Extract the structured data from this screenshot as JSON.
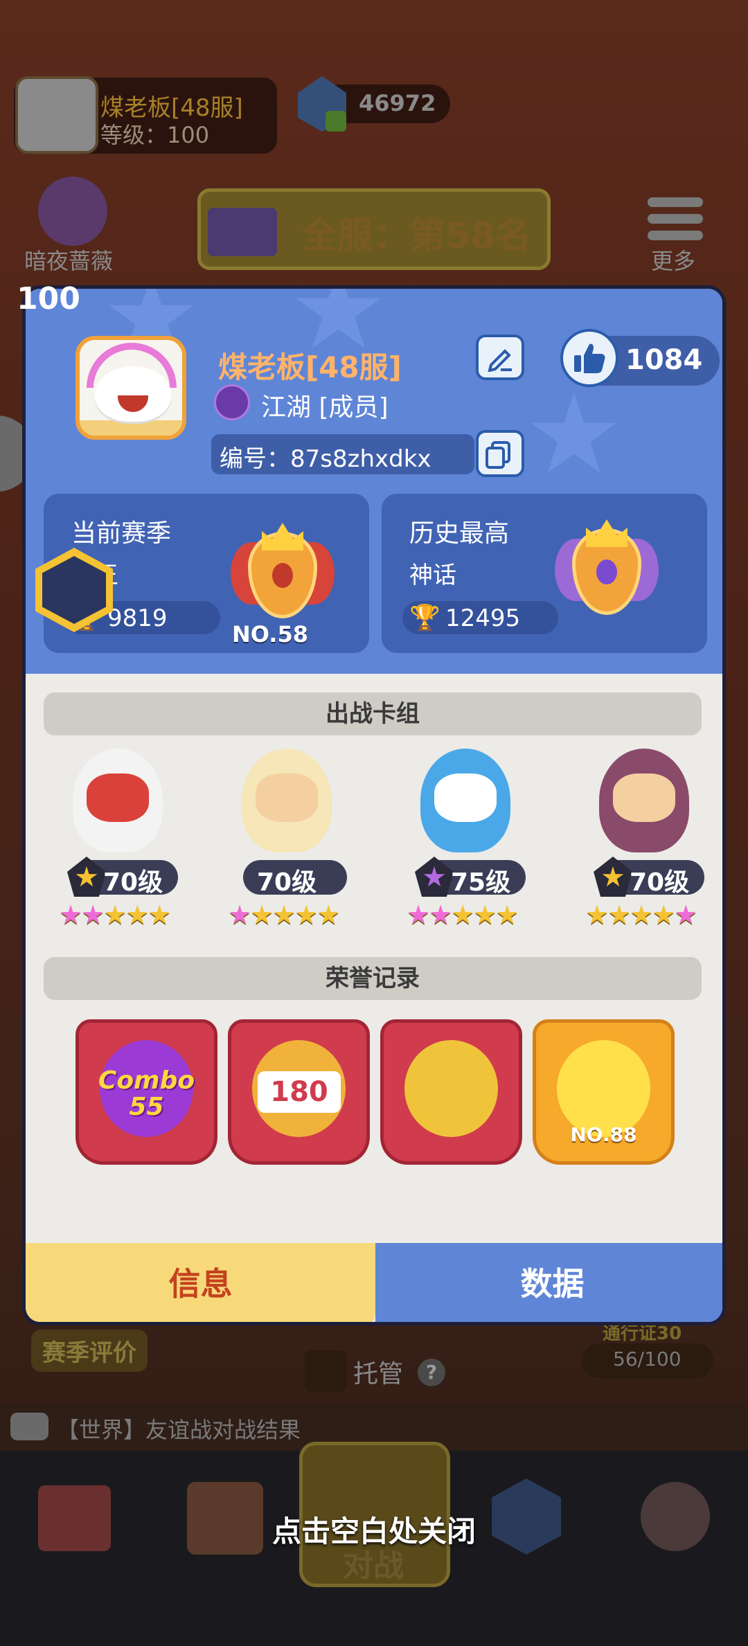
{
  "background": {
    "player_name": "煤老板[48服]",
    "player_level": "等级：100",
    "gems": "46972",
    "character_name": "暗夜蔷薇",
    "server_rank": "全服：第58名",
    "more_label": "更多",
    "season_eval": "赛季评价",
    "pass_label": "通行证30",
    "pass_progress": "56/100",
    "auto_label": "托管",
    "chat_text": "【世界】友谊战对战结果",
    "battle_label": "对战",
    "close_hint": "点击空白处关闭"
  },
  "profile": {
    "level": "100",
    "name": "煤老板[48服]",
    "guild": "江湖 [成员]",
    "id_text": "编号：87s8zhxdkx",
    "likes": "1084"
  },
  "season_current": {
    "title": "当前赛季",
    "tier": "国王",
    "trophies": "9819",
    "rank": "NO.58"
  },
  "season_history": {
    "title": "历史最高",
    "tier": "神话",
    "trophies": "12495"
  },
  "deck": {
    "header": "出战卡组",
    "heroes": [
      {
        "level": "70级",
        "stars": "★★★★★"
      },
      {
        "level": "70级",
        "stars": "★★★★★"
      },
      {
        "level": "75级",
        "stars": "★★★★★"
      },
      {
        "level": "70级",
        "stars": "★★★★★"
      }
    ]
  },
  "honor": {
    "header": "荣誉记录",
    "combo": "Combo 55",
    "days": "180",
    "rank": "NO.88"
  },
  "tabs": {
    "info": "信息",
    "data": "数据"
  },
  "colors": {
    "panel_blue": "#5f85d6",
    "card_blue": "#4163b4",
    "name_orange": "#ffb36b",
    "tab_active": "#f7d97a",
    "tab_active_text": "#c4421e",
    "honor_red": "#d03b4d",
    "honor_gold": "#f6a92a"
  }
}
